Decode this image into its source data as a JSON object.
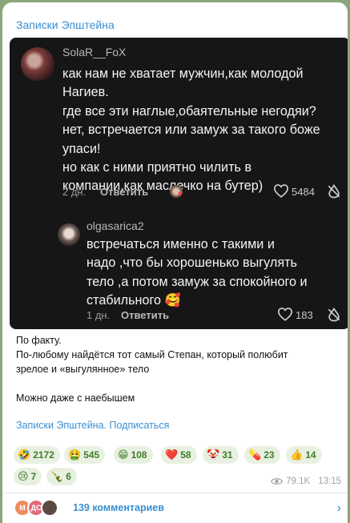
{
  "channel": {
    "name": "Записки Эпштейна"
  },
  "comment1": {
    "username": "SolaR__FoX",
    "text": "как нам не хватает мужчин,как молодой\nНагиев.\nгде все эти наглые,обаятельные негодяи?\nнет, встречается или замуж за такого боже\nупаси!\nно как с ними приятно чилить в\nкомпании,как маслечко на бутер)",
    "time": "2 дн.",
    "reply_label": "Ответить",
    "likes": "5484"
  },
  "comment2": {
    "username": "olgasarica2",
    "text": "встречаться именно с такими и\nнадо ,что бы хорошенько выгулять\nтело ,а потом замуж за спокойного и\nстабильного 🥰",
    "time": "1 дн.",
    "reply_label": "Ответить",
    "likes": "183"
  },
  "post": {
    "line1": "По факту.",
    "line2": "По-любому найдётся тот самый Степан, который полюбит",
    "line3": "зрелое и «выгулянное» тело",
    "line4": "Можно даже с наебышем",
    "link": "Записки Эпштейна. Подписаться"
  },
  "reactions": [
    {
      "emoji": "🤣",
      "count": "2172"
    },
    {
      "emoji": "🤮",
      "count": "545"
    },
    {
      "emoji": "😁",
      "count": "108"
    },
    {
      "emoji": "❤️",
      "count": "58"
    },
    {
      "emoji": "🤡",
      "count": "31"
    },
    {
      "emoji": "💊",
      "count": "23"
    },
    {
      "emoji": "👍",
      "count": "14"
    },
    {
      "emoji": "😢",
      "count": "7"
    },
    {
      "emoji": "🍾",
      "count": "6"
    }
  ],
  "views": "79.1K",
  "time": "13:15",
  "comments": {
    "label": "139 комментариев",
    "avatars": [
      "М",
      "ДС",
      ""
    ]
  },
  "colors": {
    "accent": "#3a8fd1",
    "chip_bg": "#e8f1e1",
    "chip_text": "#3f7d2a",
    "dark": "#161616"
  }
}
